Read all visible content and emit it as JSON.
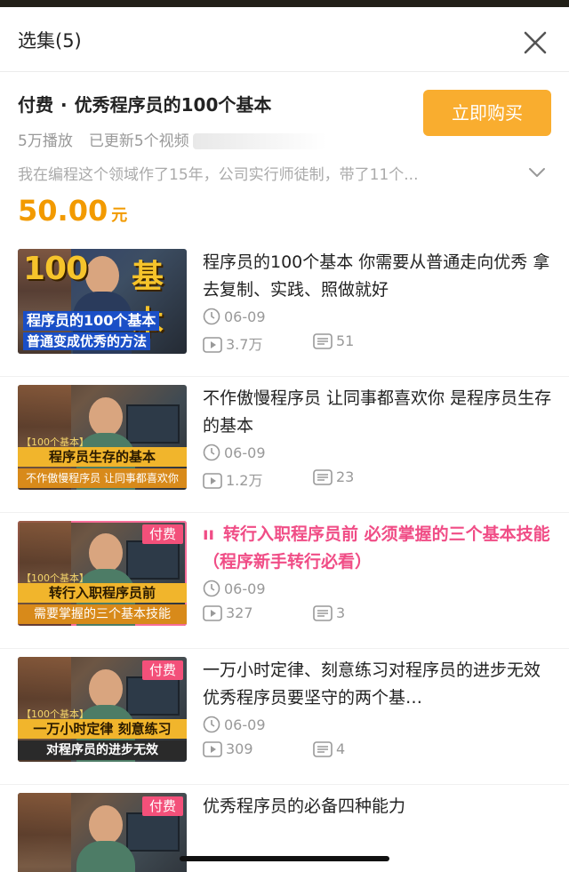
{
  "header": {
    "title": "选集(5)"
  },
  "course": {
    "badge": "付费",
    "separator": "·",
    "title": "优秀程序员的100个基本",
    "buy_label": "立即购买",
    "plays": "5万播放",
    "updated": "已更新5个视频",
    "description": "我在编程这个领域作了15年，公司实行师徒制，带了11个...",
    "price": "50.00",
    "price_unit": "元"
  },
  "episodes": [
    {
      "title": "程序员的100个基本   你需要从普通走向优秀 拿去复制、实践、照做就好",
      "date": "06-09",
      "plays": "3.7万",
      "comments": "51",
      "thumb": {
        "big_left": "100",
        "big_right": "基本",
        "cap1": "程序员的100个基本",
        "cap2": "普通变成优秀的方法"
      }
    },
    {
      "title": "不作傲慢程序员 让同事都喜欢你 是程序员生存的基本",
      "date": "06-09",
      "plays": "1.2万",
      "comments": "23",
      "thumb": {
        "tagline": "【100个基本】",
        "bar1": "程序员生存的基本",
        "bar2": "不作傲慢程序员 让同事都喜欢你"
      }
    },
    {
      "title": "转行入职程序员前  必须掌握的三个基本技能（程序新手转行必看）",
      "playing_icon": "ıı",
      "date": "06-09",
      "plays": "327",
      "comments": "3",
      "thumb": {
        "paid": "付费",
        "tagline": "【100个基本】",
        "bar1": "转行入职程序员前",
        "bar2": "需要掌握的三个基本技能"
      }
    },
    {
      "title": "一万小时定律、刻意练习对程序员的进步无效 优秀程序员要坚守的两个基…",
      "date": "06-09",
      "plays": "309",
      "comments": "4",
      "thumb": {
        "paid": "付费",
        "tagline": "【100个基本】",
        "bar1": "一万小时定律 刻意练习",
        "bar2": "对程序员的进步无效"
      }
    },
    {
      "title": "优秀程序员的必备四种能力",
      "thumb": {
        "paid": "付费"
      }
    }
  ],
  "colors": {
    "accent": "#f9ad2f",
    "price": "#f29a00",
    "active": "#f04d86",
    "paid_tag": "#f3507a"
  },
  "icons": {
    "close": "close-icon",
    "expand": "chevron-down-icon",
    "date": "clock-icon",
    "plays": "play-icon",
    "comments": "comment-icon"
  }
}
